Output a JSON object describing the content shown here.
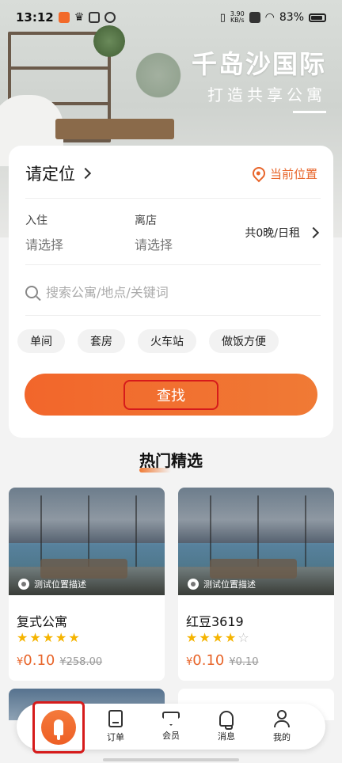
{
  "status_bar": {
    "time": "13:12",
    "speed": "3.90",
    "speed_unit": "KB/s",
    "battery": "83%"
  },
  "hero": {
    "title": "千岛沙国际",
    "subtitle": "打造共享公寓"
  },
  "location": {
    "label": "请定位",
    "current": "当前位置"
  },
  "dates": {
    "checkin_label": "入住",
    "checkin_value": "请选择",
    "checkout_label": "离店",
    "checkout_value": "请选择",
    "nights": "共0晚/日租"
  },
  "search": {
    "placeholder": "搜索公寓/地点/关键词"
  },
  "tags": [
    "单间",
    "套房",
    "火车站",
    "做饭方便"
  ],
  "find_button": "查找",
  "section_title": "热门精选",
  "listings": [
    {
      "name": "复式公寓",
      "location": "测试位置描述",
      "rating": 5,
      "currency": "¥",
      "price": "0.10",
      "original_price": "¥258.00"
    },
    {
      "name": "红豆3619",
      "location": "测试位置描述",
      "rating": 4,
      "currency": "¥",
      "price": "0.10",
      "original_price": "¥0.10"
    }
  ],
  "nav": {
    "items": [
      {
        "label": "订单",
        "icon": "order-icon"
      },
      {
        "label": "会员",
        "icon": "member-icon"
      },
      {
        "label": "消息",
        "icon": "bell-icon"
      },
      {
        "label": "我的",
        "icon": "user-icon"
      }
    ]
  },
  "colors": {
    "accent": "#f07a35",
    "highlight_box": "#d61b1b",
    "star": "#f5b400"
  }
}
